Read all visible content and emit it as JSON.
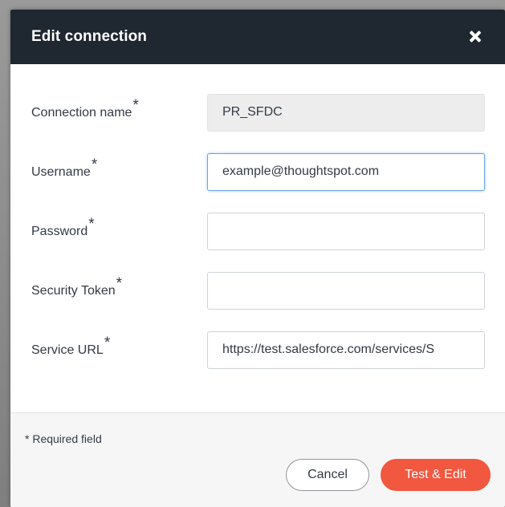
{
  "dialog": {
    "title": "Edit connection",
    "close_icon": "close-icon"
  },
  "form": {
    "required_marker": "*",
    "fields": [
      {
        "label": "Connection name",
        "value": "PR_SFDC",
        "placeholder": "",
        "readonly": true
      },
      {
        "label": "Username",
        "value": "example@thoughtspot.com",
        "placeholder": "",
        "readonly": false,
        "focused": true
      },
      {
        "label": "Password",
        "value": "",
        "placeholder": "",
        "readonly": false
      },
      {
        "label": "Security Token",
        "value": "",
        "placeholder": "",
        "readonly": false
      },
      {
        "label": "Service URL",
        "value": "https://test.salesforce.com/services/S",
        "placeholder": "",
        "readonly": false
      }
    ]
  },
  "footer": {
    "required_note": "* Required field",
    "cancel_label": "Cancel",
    "submit_label": "Test & Edit"
  },
  "colors": {
    "header_bg": "#1f2730",
    "primary_button": "#f2573f",
    "focus_border": "#6aa3e6",
    "readonly_bg": "#ededed"
  }
}
